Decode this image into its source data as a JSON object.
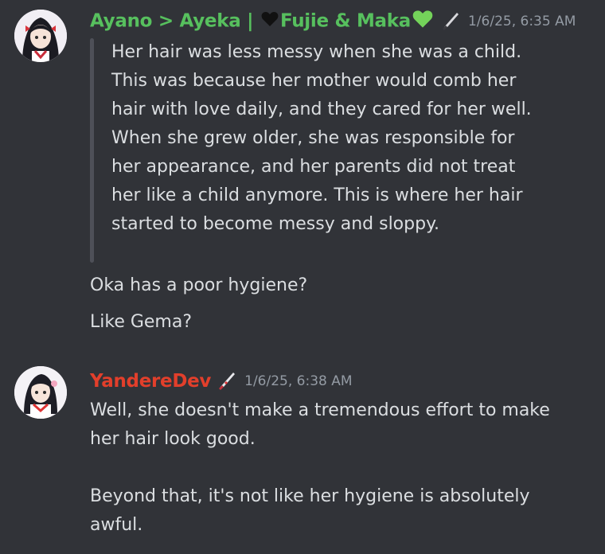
{
  "messages": [
    {
      "author": "Ayano > Ayeka | ",
      "author_suffix": "Fujie & Maka",
      "author_color": "#57c05e",
      "role_icon": "knife-icon",
      "timestamp": "1/6/25, 6:35 AM",
      "quote": "Her hair was less messy when she was a child. This was because her mother would comb her hair with love daily, and they cared for her well. When she grew older, she was responsible for her appearance, and her parents did not treat her like a child anymore. This is where her hair started to become messy and sloppy.",
      "lines": [
        "Oka has a poor hygiene?",
        "Like Gema?"
      ]
    },
    {
      "author": "YandereDev",
      "author_color": "#e23f2b",
      "role_icon": "knife-icon",
      "timestamp": "1/6/25, 6:38 AM",
      "text": "Well, she doesn't make a tremendous effort to make her hair look good.\n\nBeyond that, it's not like her hygiene is absolutely awful."
    }
  ]
}
